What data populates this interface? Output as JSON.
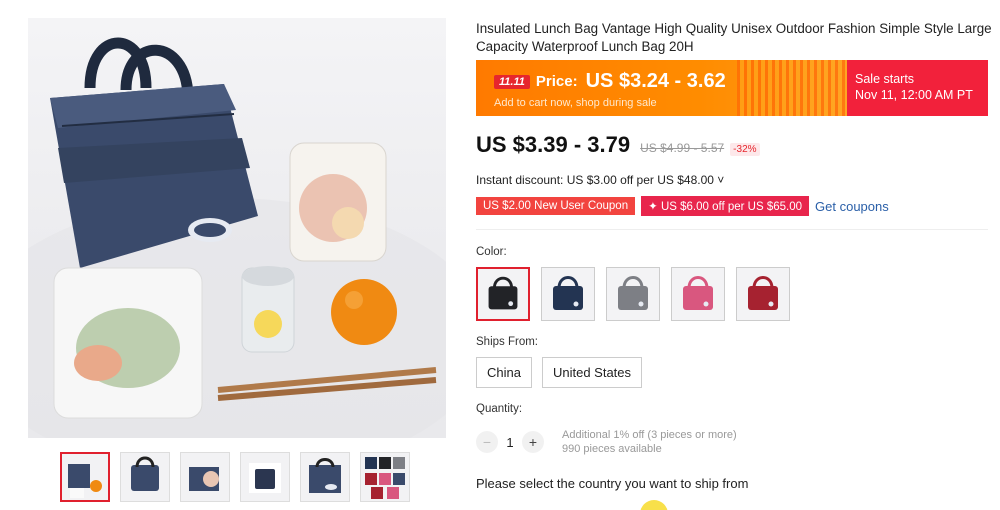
{
  "product": {
    "title": "Insulated Lunch Bag Vantage High Quality Unisex Outdoor Fashion Simple Style Large Capacity Waterproof Lunch Bag 20H"
  },
  "promo": {
    "badge": "11.11",
    "label": "Price:",
    "price": "US $3.24 - 3.62",
    "subtext": "Add to cart now, shop during sale",
    "sale_title": "Sale starts",
    "sale_date": "Nov 11, 12:00 AM PT",
    "colors": {
      "orange": "#ff8c00",
      "red": "#f2213b"
    }
  },
  "price": {
    "current": "US $3.39 - 3.79",
    "original": "US $4.99 - 5.57",
    "discount": "-32%"
  },
  "instant_discount": "Instant discount: US $3.00 off per US $48.00 ˅",
  "coupons": [
    {
      "text": "US $2.00 New User Coupon"
    },
    {
      "text": "✦ US $6.00 off per US $65.00"
    }
  ],
  "get_coupons": "Get coupons",
  "color_section": {
    "label": "Color:",
    "options": [
      {
        "name": "black",
        "hex": "#222327"
      },
      {
        "name": "navy",
        "hex": "#233452"
      },
      {
        "name": "grey",
        "hex": "#7d7f85"
      },
      {
        "name": "pink",
        "hex": "#d9577f"
      },
      {
        "name": "red",
        "hex": "#a62230"
      }
    ]
  },
  "ships_from": {
    "label": "Ships From:",
    "options": [
      "China",
      "United States"
    ]
  },
  "quantity": {
    "label": "Quantity:",
    "value": "1",
    "minus": "−",
    "plus": "+",
    "note1": "Additional 1% off (3 pieces or more)",
    "note2": "990 pieces available"
  },
  "ship_note": "Please select the country you want to ship from"
}
